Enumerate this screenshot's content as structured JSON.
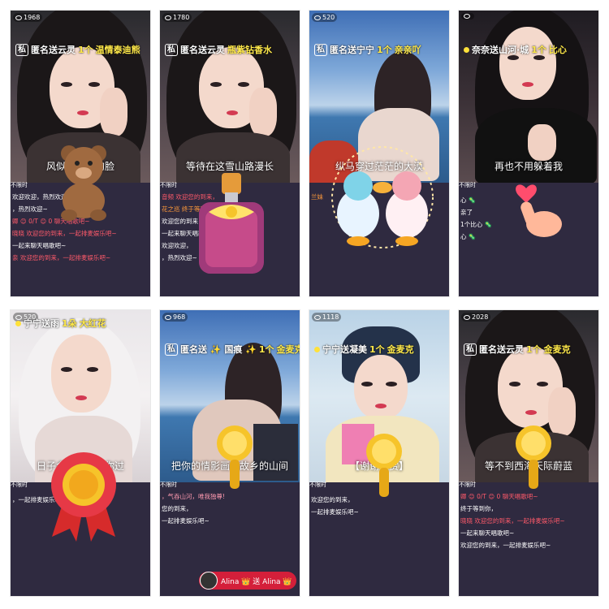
{
  "panels": [
    {
      "viewers": "1968",
      "prefix": "匿名送云灵",
      "amount": "1个",
      "gift": "温情泰迪熊",
      "lyric": "风似刀割我的脸",
      "tag": "不限时",
      "chat": [
        "欢迎欢迎，热烈欢迎~",
        "，热烈欢迎~",
        "卿 😊 0/T 😊 0      聊天唱歌吧~",
        "晓晓 欢迎您的到来，一起排麦娱乐吧~",
        "一起来聊天唱歌吧~",
        "亲 欢迎您的到来，一起排麦娱乐吧~"
      ],
      "gift_icon": "teddy-bear-icon"
    },
    {
      "viewers": "1780",
      "prefix": "匿名送云灵",
      "amount": "",
      "gift": "瓶紫钻香水",
      "lyric": "等待在这雪山路漫长",
      "tag": "不限时",
      "chat": [
        "音频 欢迎您的到来，",
        "花之巡 终于等到你，",
        "欢迎您的到来，",
        "一起来聊天唱歌吧~",
        "欢迎欢迎，",
        "，热烈欢迎~"
      ],
      "gift_icon": "perfume-bottle-icon"
    },
    {
      "viewers": "520",
      "prefix": "匿名送宁宁",
      "amount": "1个",
      "gift": "亲亲吖",
      "lyric": "纵马穿过茫茫的大漠",
      "tag": "",
      "chat": [
        "兰妹"
      ],
      "gift_icon": "kissing-ducks-icon"
    },
    {
      "viewers": "",
      "prefix": "奈奈送山河·城",
      "amount": "1个",
      "gift": "比心",
      "lyric": "再也不用躲着我",
      "tag": "不限时",
      "chat": [
        "",
        "心 🦠",
        "亲了",
        "",
        "1个比心 🦠",
        "心 🦠"
      ],
      "gift_icon": "finger-heart-icon"
    },
    {
      "viewers": "520",
      "prefix": "宁宁送雨",
      "amount": "1朵",
      "gift": "大红花",
      "lyric": "日子会有别人陪你过",
      "tag": "不限时",
      "chat": [
        "",
        "",
        "",
        "",
        "",
        "，一起排麦娱乐吧~"
      ],
      "gift_icon": "gold-medal-ribbon-icon"
    },
    {
      "viewers": "968",
      "prefix": "匿名送 ✨ 国痕 ✨",
      "amount": "1个",
      "gift": "金麦克",
      "lyric": "把你的情影画在故乡的山间",
      "tag": "不限时",
      "chat": [
        "，气吞山河，唯我独尊!",
        "",
        "您的到来，",
        "一起排麦娱乐吧~"
      ],
      "gift_icon": "gold-mic-icon",
      "pill": "Alina 👑 送 Alina 👑"
    },
    {
      "viewers": "1118",
      "prefix": "宁宁送凝美",
      "amount": "1个",
      "gift": "金麦克",
      "lyric": "【谢谢欣赏】",
      "tag": "不限时",
      "chat": [
        "",
        "",
        "",
        "欢迎您的到来，",
        "一起排麦娱乐吧~"
      ],
      "gift_icon": "gold-mic-icon"
    },
    {
      "viewers": "2028",
      "prefix": "匿名送云灵",
      "amount": "1个",
      "gift": "金麦克",
      "lyric": "等不到西海天际蔚蓝",
      "tag": "不限时",
      "chat": [
        "卿 😊 0/T 😊 0      聊天唱歌吧~",
        "终于等到你，",
        "晓晓 欢迎您的到来，一起排麦娱乐吧~",
        "一起来聊天唱歌吧~",
        "欢迎您的到来，一起排麦娱乐吧~"
      ],
      "gift_icon": "gold-mic-icon"
    }
  ],
  "colors": {
    "chat_bg": "#2f2a40",
    "gift_name": "#ffe94a",
    "lyric_text": "#ffffff",
    "pill_bg": "#d41f3a"
  }
}
